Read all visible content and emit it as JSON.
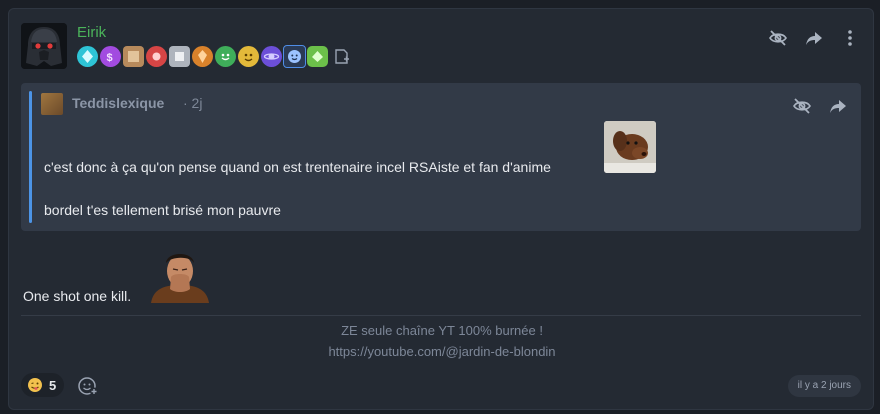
{
  "post": {
    "author": "Eirik",
    "message": "One shot one kill.",
    "signature": {
      "line1": "ZE seule chaîne YT 100% burnée !",
      "line2": "https://youtube.com/@jardin-de-blondin"
    },
    "timestamp": "il y a 2 jours",
    "badges": [
      {
        "icon": "cyan-gem-badge",
        "color": "#2ec4d6"
      },
      {
        "icon": "purple-coin-badge",
        "color": "#a24be0"
      },
      {
        "icon": "bronze-cube-badge",
        "color": "#b78a5c"
      },
      {
        "icon": "red-gem-badge",
        "color": "#d64545"
      },
      {
        "icon": "silver-cube-badge",
        "color": "#aeb4bd"
      },
      {
        "icon": "orange-gem-badge",
        "color": "#d9822b"
      },
      {
        "icon": "green-smile-badge",
        "color": "#3fae5a"
      },
      {
        "icon": "yellow-face-badge",
        "color": "#e3b93a"
      },
      {
        "icon": "violet-planet-badge",
        "color": "#6c4fd8"
      },
      {
        "icon": "blue-face-badge",
        "color": "#4f8de6"
      },
      {
        "icon": "green-gem-badge",
        "color": "#6cc04a"
      }
    ]
  },
  "quote": {
    "author": "Teddislexique",
    "time": "· 2j",
    "line1": "c'est donc à ça qu'on pense quand on est trentenaire incel RSAiste et fan d'anime",
    "line2": "bordel t'es tellement brisé mon pauvre"
  },
  "reactions": [
    {
      "emoji": "tongue-face-icon",
      "count": "5"
    }
  ],
  "colors": {
    "accent": "#4c94e6",
    "author": "#4bb35a",
    "background": "#242a33"
  }
}
